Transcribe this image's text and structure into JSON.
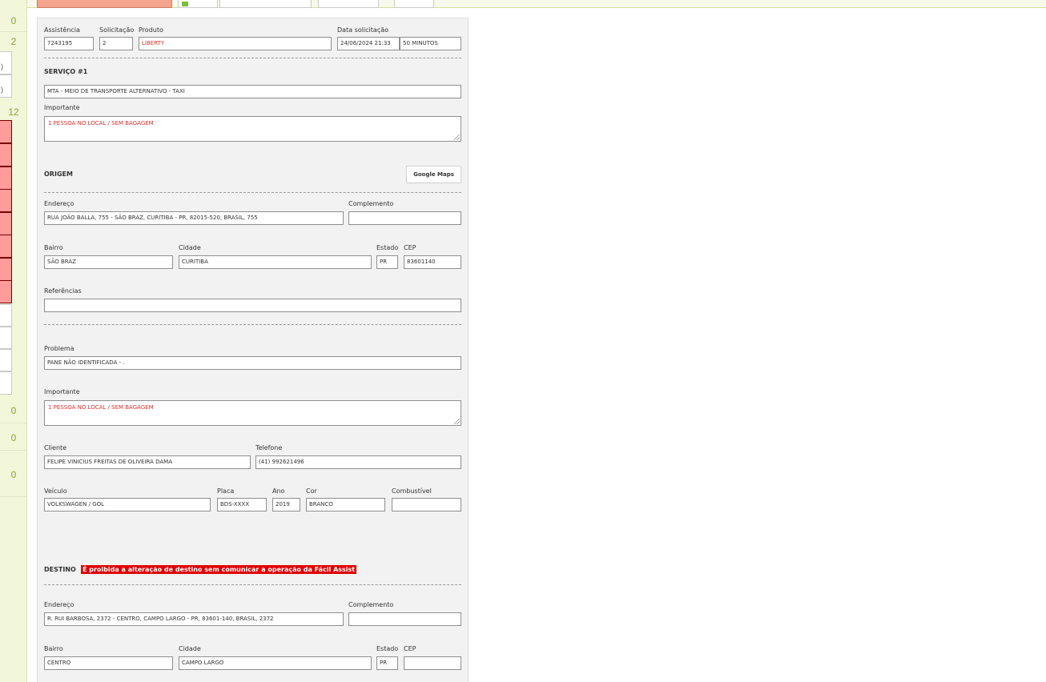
{
  "left_strip": {
    "counts": [
      "0",
      "2",
      "12",
      "0",
      "0",
      "0"
    ],
    "row_fragments": [
      ")",
      ")"
    ]
  },
  "form": {
    "header": {
      "assistencia_label": "Assistência",
      "assistencia_value": "7243195",
      "solicitacao_label": "Solicitação",
      "solicitacao_value": "2",
      "produto_label": "Produto",
      "produto_value": "LIBERTY",
      "data_label": "Data solicitação",
      "data_value": "24/06/2024 21:33",
      "duracao_value": "50 MINUTOS"
    },
    "servico": {
      "title": "SERVIÇO #1",
      "value": "MTA - MEIO DE TRANSPORTE ALTERNATIVO - TAXI",
      "importante_label": "Importante",
      "importante_value": "1 PESSOA NO LOCAL / SEM BAGAGEM"
    },
    "origem": {
      "title": "ORIGEM",
      "maps_button": "Google Maps",
      "endereco_label": "Endereço",
      "endereco_value": "RUA JOÃO BALLA, 755 - SÃO BRAZ, CURITIBA - PR, 82015-520, BRASIL, 755",
      "complemento_label": "Complemento",
      "complemento_value": "",
      "bairro_label": "Bairro",
      "bairro_value": "SÃO BRAZ",
      "cidade_label": "Cidade",
      "cidade_value": "CURITIBA",
      "estado_label": "Estado",
      "estado_value": "PR",
      "cep_label": "CEP",
      "cep_value": "83601140",
      "referencias_label": "Referências",
      "referencias_value": ""
    },
    "detalhes": {
      "problema_label": "Problema",
      "problema_value": "PANE NÃO IDENTIFICADA - .",
      "importante_label": "Importante",
      "importante_value": "1 PESSOA NO LOCAL / SEM BAGAGEM",
      "cliente_label": "Cliente",
      "cliente_value": "FELIPE VINICIUS FREITAS DE OLIVEIRA DAMA",
      "telefone_label": "Telefone",
      "telefone_value": "(41) 992621496",
      "veiculo_label": "Veículo",
      "veiculo_value": "VOLKSWAGEN / GOL",
      "placa_label": "Placa",
      "placa_value": "BDS-XXXX",
      "ano_label": "Ano",
      "ano_value": "2019",
      "cor_label": "Cor",
      "cor_value": "BRANCO",
      "combustivel_label": "Combustível",
      "combustivel_value": ""
    },
    "destino": {
      "title": "DESTINO",
      "warning": "É proibida a alteração de destino sem comunicar a operação da Fácil Assist",
      "endereco_label": "Endereço",
      "endereco_value": "R. RUI BARBOSA, 2372 - CENTRO, CAMPO LARGO - PR, 83601-140, BRASIL, 2372",
      "complemento_label": "Complemento",
      "complemento_value": "",
      "bairro_label": "Bairro",
      "bairro_value": "CENTRO",
      "cidade_label": "Cidade",
      "cidade_value": "CAMPO LARGO",
      "estado_label": "Estado",
      "estado_value": "PR",
      "cep_label": "CEP",
      "cep_value": ""
    }
  },
  "colors": {
    "accent_green": "#8aa23c",
    "warning_red": "#e00000",
    "value_red": "#e0302a",
    "row_highlight": "#ff9b9b"
  }
}
